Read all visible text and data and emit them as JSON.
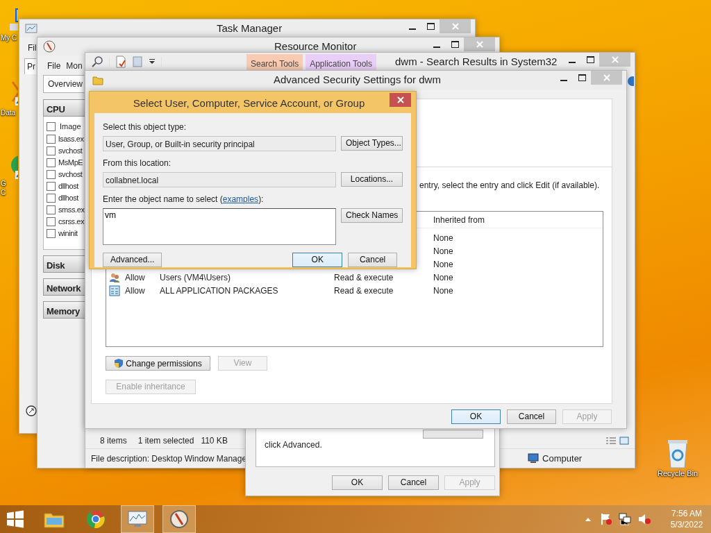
{
  "desktop_icons": [
    {
      "kind": "computer",
      "lines": [
        "My C"
      ]
    },
    {
      "kind": "shortcut",
      "lines": [
        "Data"
      ]
    },
    {
      "kind": "browser",
      "lines": [
        "G",
        "C"
      ]
    }
  ],
  "recycle_bin": {
    "label": "Recycle Bin"
  },
  "task_manager": {
    "title": "Task Manager",
    "menu": [
      "Fil"
    ],
    "tabs": [
      {
        "label": "Pr",
        "selected": true
      }
    ]
  },
  "resource_monitor": {
    "title": "Resource Monitor",
    "menu": [
      "File",
      "Mon"
    ],
    "tabs": [
      {
        "label": "Overview",
        "selected": true
      }
    ],
    "sections": [
      {
        "title": "CPU",
        "expanded": true,
        "header_checked": false,
        "column": "Image",
        "rows": [
          {
            "image": "lsass.ex",
            "checked": false
          },
          {
            "image": "svchost",
            "checked": false
          },
          {
            "image": "MsMpE",
            "checked": false
          },
          {
            "image": "svchost",
            "checked": false
          },
          {
            "image": "dllhost",
            "checked": false
          },
          {
            "image": "dllhost",
            "checked": false
          },
          {
            "image": "smss.ex",
            "checked": false
          },
          {
            "image": "csrss.ex",
            "checked": false
          },
          {
            "image": "wininit",
            "checked": false
          }
        ]
      },
      {
        "title": "Disk",
        "expanded": false
      },
      {
        "title": "Network",
        "expanded": false
      },
      {
        "title": "Memory",
        "expanded": false
      }
    ]
  },
  "explorer": {
    "title": "dwm - Search Results in System32",
    "context_tabs": [
      {
        "label": "Search Tools",
        "color": "#f9cbb3"
      },
      {
        "label": "Application Tools",
        "color": "#e9cff7"
      }
    ],
    "status": [
      "8 items",
      "1 item selected",
      "110 KB"
    ],
    "details": {
      "description": "File description: Desktop Window Manage",
      "location": "Computer"
    }
  },
  "properties_dialog": {
    "text": "click Advanced.",
    "buttons": [
      {
        "label": "OK",
        "disabled": false
      },
      {
        "label": "Cancel",
        "disabled": false
      },
      {
        "label": "Apply",
        "disabled": true
      }
    ]
  },
  "advanced_security": {
    "title": "Advanced Security Settings for dwm",
    "instructions": "entry, select the entry and click Edit (if available).",
    "table": {
      "column": "Inherited from",
      "rows": [
        {
          "inherited_from": "None"
        },
        {
          "inherited_from": "None"
        },
        {
          "inherited_from": "None"
        },
        {
          "kind": "group",
          "type": "Allow",
          "principal": "Users (VM4\\Users)",
          "access": "Read & execute",
          "inherited_from": "None"
        },
        {
          "kind": "package",
          "type": "Allow",
          "principal": "ALL APPLICATION PACKAGES",
          "access": "Read & execute",
          "inherited_from": "None"
        }
      ]
    },
    "actions": [
      {
        "label": "Change permissions",
        "kind": "shield",
        "disabled": false
      },
      {
        "label": "View",
        "kind": "plain",
        "disabled": true
      },
      {
        "label": "Enable inheritance",
        "kind": "plain",
        "disabled": true
      }
    ],
    "buttons": [
      {
        "label": "OK",
        "default": true,
        "disabled": false
      },
      {
        "label": "Cancel",
        "default": false,
        "disabled": false
      },
      {
        "label": "Apply",
        "default": false,
        "disabled": true
      }
    ]
  },
  "select_dialog": {
    "title": "Select User, Computer, Service Account, or Group",
    "object_type": {
      "label": "Select this object type:",
      "value": "User, Group, or Built-in security principal",
      "button": "Object Types..."
    },
    "location": {
      "label": "From this location:",
      "value": "collabnet.local",
      "button": "Locations..."
    },
    "object_name": {
      "label": "Enter the object name to select (",
      "link": "examples",
      "label_end": "):",
      "value": "vm",
      "button": "Check Names"
    },
    "buttons": [
      {
        "label": "Advanced...",
        "default": false
      },
      {
        "label": "OK",
        "default": true
      },
      {
        "label": "Cancel",
        "default": false
      }
    ]
  },
  "taskbar": {
    "apps": [
      {
        "kind": "folder",
        "active": false
      },
      {
        "kind": "browser",
        "active": false
      },
      {
        "kind": "monitor",
        "active": true
      },
      {
        "kind": "gauge",
        "active": true
      }
    ],
    "time": "7:56 AM",
    "date": "5/3/2022"
  }
}
